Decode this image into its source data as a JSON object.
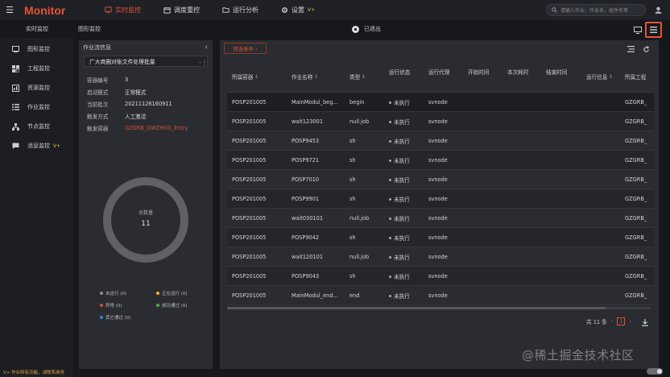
{
  "app": {
    "logo": "Monitor"
  },
  "topnav": [
    {
      "label": "实时监控",
      "icon": "monitor-icon",
      "active": true
    },
    {
      "label": "调度重控",
      "icon": "calendar-icon"
    },
    {
      "label": "运行分析",
      "icon": "folder-icon"
    },
    {
      "label": "设置",
      "icon": "gear-icon",
      "badge": "V+"
    }
  ],
  "search": {
    "placeholder": "请输入作业、作业名、组件名等"
  },
  "subbar": {
    "left_title": "实时监控",
    "page_title": "图形监控",
    "status_text": "已退出"
  },
  "sidebar": {
    "items": [
      {
        "label": "图形监控",
        "icon": "image-icon"
      },
      {
        "label": "工程监控",
        "icon": "grid-icon"
      },
      {
        "label": "资源监控",
        "icon": "chart-icon"
      },
      {
        "label": "作业监控",
        "icon": "list-icon"
      },
      {
        "label": "节点监控",
        "icon": "node-icon"
      },
      {
        "label": "消息监控",
        "icon": "message-icon",
        "badge": "V+"
      }
    ],
    "footer": "V+ 作业特有功能，请联系商务"
  },
  "left_panel": {
    "header": "作业流信息",
    "select_value": "广大商圈对账文件处理批量",
    "info": [
      {
        "k": "容器编号",
        "v": "3"
      },
      {
        "k": "启动模式",
        "v": "正常模式"
      },
      {
        "k": "当前批次",
        "v": "20211126160911"
      },
      {
        "k": "触发方式",
        "v": "人工激活"
      },
      {
        "k": "触发容器",
        "v": "GZGRB_GWZHSG_Entry",
        "red": true
      }
    ],
    "donut": {
      "label": "总数量",
      "value": "11"
    },
    "legend": [
      {
        "label": "未运行 (0)",
        "color": "#8c8c8c"
      },
      {
        "label": "正在运行 (0)",
        "color": "#f0b429"
      },
      {
        "label": "异常 (0)",
        "color": "#d6523a"
      },
      {
        "label": "成功通过 (0)",
        "color": "#4caf50"
      },
      {
        "label": "其它通过 (0)",
        "color": "#2f80ed"
      }
    ]
  },
  "right_panel": {
    "filter_label": "筛选条件 ›",
    "columns": [
      "所属容器",
      "作业名称",
      "类型",
      "运行状态",
      "运行代理",
      "开始时间",
      "本次耗时",
      "结束时间",
      "运行信息",
      "所属工程"
    ],
    "rows": [
      [
        "POSP201005",
        "MainModul_beg...",
        "begin",
        "未执行",
        "svnode",
        "",
        "",
        "",
        "",
        "GZGRB_"
      ],
      [
        "POSP201005",
        "wait123001",
        "null.job",
        "未执行",
        "svnode",
        "",
        "",
        "",
        "",
        "GZGRB_"
      ],
      [
        "POSP201005",
        "POSP9453",
        "sh",
        "未执行",
        "svnode",
        "",
        "",
        "",
        "",
        "GZGRB_"
      ],
      [
        "POSP201005",
        "POSP9721",
        "sh",
        "未执行",
        "svnode",
        "",
        "",
        "",
        "",
        "GZGRB_"
      ],
      [
        "POSP201005",
        "POSP7010",
        "sh",
        "未执行",
        "svnode",
        "",
        "",
        "",
        "",
        "GZGRB_"
      ],
      [
        "POSP201005",
        "POSP9901",
        "sh",
        "未执行",
        "svnode",
        "",
        "",
        "",
        "",
        "GZGRB_"
      ],
      [
        "POSP201005",
        "wait030101",
        "null.job",
        "未执行",
        "svnode",
        "",
        "",
        "",
        "",
        "GZGRB_"
      ],
      [
        "POSP201005",
        "POSP9042",
        "sh",
        "未执行",
        "svnode",
        "",
        "",
        "",
        "",
        "GZGRB_"
      ],
      [
        "POSP201005",
        "wait120101",
        "null.job",
        "未执行",
        "svnode",
        "",
        "",
        "",
        "",
        "GZGRB_"
      ],
      [
        "POSP201005",
        "POSP9043",
        "sh",
        "未执行",
        "svnode",
        "",
        "",
        "",
        "",
        "GZGRB_"
      ],
      [
        "POSP201005",
        "MainModul_end...",
        "end",
        "未执行",
        "svnode",
        "",
        "",
        "",
        "",
        "GZGRB_"
      ]
    ],
    "pager": {
      "total": "共 11 条",
      "page": "1"
    }
  },
  "watermark": "@稀土掘金技术社区"
}
